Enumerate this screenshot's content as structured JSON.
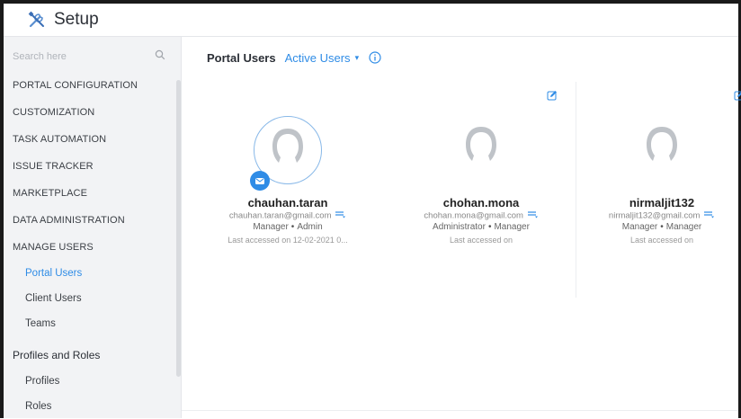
{
  "app": {
    "title": "Setup"
  },
  "sidebar": {
    "search_placeholder": "Search here",
    "items": [
      {
        "label": "PORTAL CONFIGURATION"
      },
      {
        "label": "CUSTOMIZATION"
      },
      {
        "label": "TASK AUTOMATION"
      },
      {
        "label": "ISSUE TRACKER"
      },
      {
        "label": "MARKETPLACE"
      },
      {
        "label": "DATA ADMINISTRATION"
      },
      {
        "label": "MANAGE USERS"
      }
    ],
    "manage_users_sub": [
      {
        "label": "Portal Users",
        "active": true
      },
      {
        "label": "Client Users",
        "active": false
      },
      {
        "label": "Teams",
        "active": false
      }
    ],
    "profiles_group": {
      "label": "Profiles and Roles",
      "items": [
        {
          "label": "Profiles"
        },
        {
          "label": "Roles"
        }
      ]
    }
  },
  "main": {
    "title": "Portal Users",
    "filter": "Active Users",
    "users": [
      {
        "username": "chauhan.taran",
        "email": "chauhan.taran@gmail.com",
        "role": "Manager",
        "profile": "Admin",
        "last_access": "Last accessed on 12-02-2021 0..."
      },
      {
        "username": "chohan.mona",
        "email": "chohan.mona@gmail.com",
        "role": "Administrator",
        "profile": "Manager",
        "last_access": "Last accessed on"
      },
      {
        "username": "nirmaljit132",
        "email": "nirmaljit132@gmail.com",
        "role": "Manager",
        "profile": "Manager",
        "last_access": "Last accessed on"
      }
    ]
  },
  "colors": {
    "accent": "#2f8ce6",
    "sidebar_bg": "#f2f3f5"
  },
  "icons": {
    "setup": "tools-icon",
    "search": "search-icon",
    "info": "info-icon",
    "edit": "edit-icon",
    "mail": "mail-icon",
    "avatar": "avatar-placeholder-icon",
    "badge": "portal-badge-icon"
  }
}
